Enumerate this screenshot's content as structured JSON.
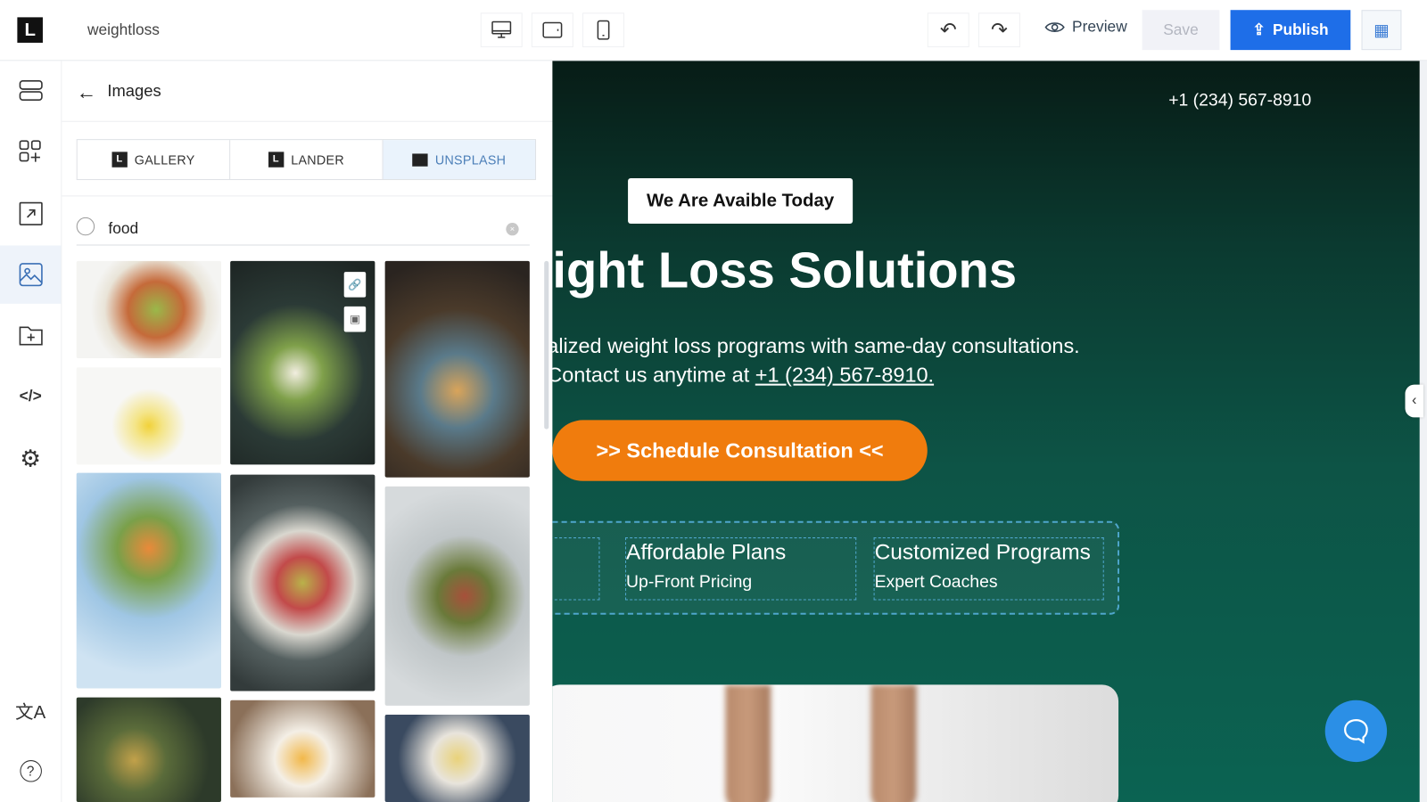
{
  "topbar": {
    "logo": "L",
    "project_name": "weightloss",
    "devices": [
      "desktop-icon",
      "tablet-icon",
      "mobile-icon"
    ],
    "preview_label": "Preview",
    "save_label": "Save",
    "publish_label": "Publish",
    "accent": "#1e6ee8"
  },
  "rail": {
    "items": [
      "sections-icon",
      "elements-icon",
      "popup-icon",
      "images-icon",
      "folder-add-icon",
      "code-icon",
      "settings-icon",
      "translate-icon",
      "help-icon"
    ],
    "active": "images-icon"
  },
  "panel": {
    "title": "Images",
    "tabs": [
      {
        "label": "GALLERY"
      },
      {
        "label": "LANDER"
      },
      {
        "label": "UNSPLASH"
      }
    ],
    "active_tab": "UNSPLASH",
    "search": {
      "value": "food"
    }
  },
  "canvas": {
    "phone": "+1 (234) 567-8910",
    "badge": "We Are Avaible Today",
    "headline": "ight Loss Solutions",
    "sub_line1": "alized weight loss programs with same-day consultations.",
    "sub_line2_prefix": "Contact us anytime at ",
    "sub_link": "+1 (234) 567-8910.",
    "cta": ">> Schedule Consultation <<",
    "features": [
      {
        "title": "Affordable Plans",
        "subtitle": "Up-Front Pricing"
      },
      {
        "title": "Customized Programs",
        "subtitle": "Expert Coaches"
      }
    ],
    "cta_color": "#f07c0d"
  }
}
